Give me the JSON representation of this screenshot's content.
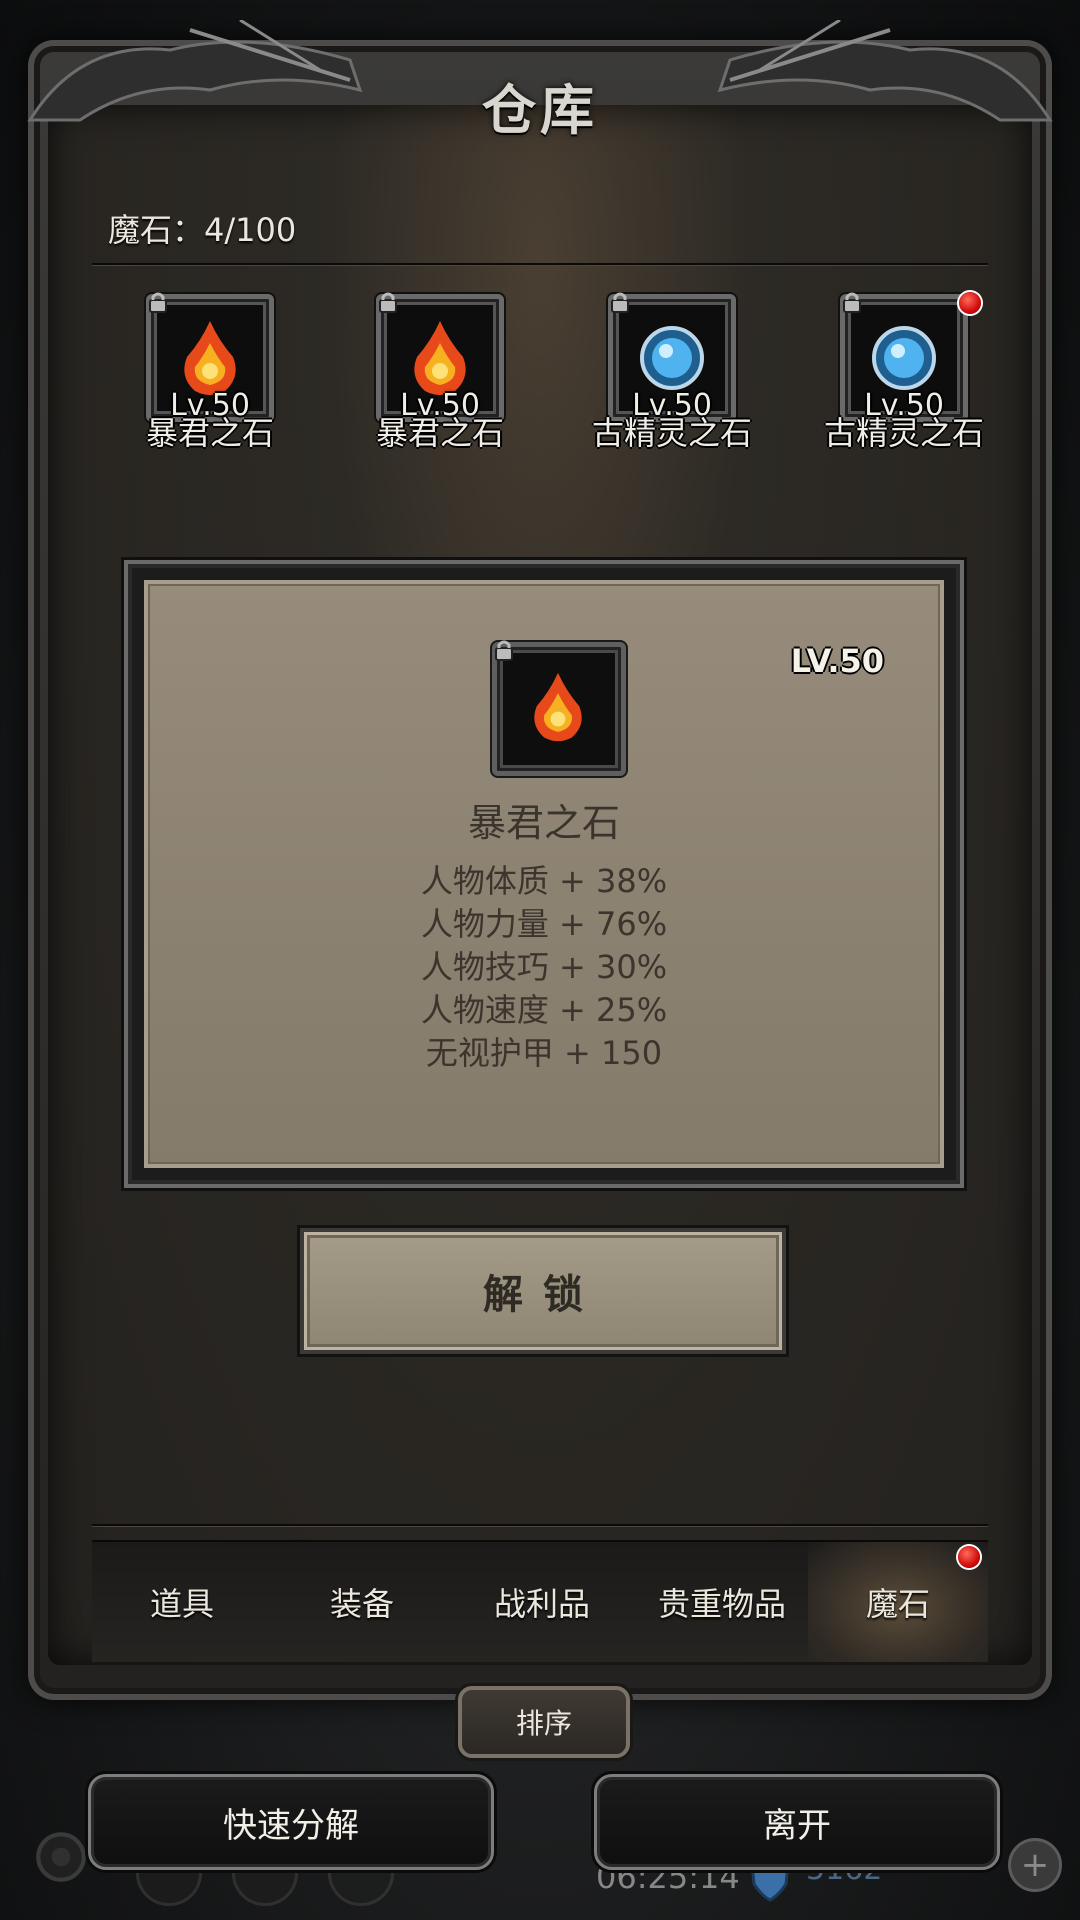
{
  "window": {
    "title": "仓库"
  },
  "inventory": {
    "label": "魔石：4/100"
  },
  "items": [
    {
      "level": "Lv.50",
      "name": "暴君之石",
      "type": "fire"
    },
    {
      "level": "Lv.50",
      "name": "暴君之石",
      "type": "fire"
    },
    {
      "level": "Lv.50",
      "name": "古精灵之石",
      "type": "ice"
    },
    {
      "level": "Lv.50",
      "name": "古精灵之石",
      "type": "ice"
    }
  ],
  "detail": {
    "level": "LV.50",
    "name": "暴君之石",
    "stats": [
      "人物体质 + 38%",
      "人物力量 + 76%",
      "人物技巧 + 30%",
      "人物速度 + 25%",
      "无视护甲 + 150"
    ]
  },
  "actions": {
    "unlock": "解锁",
    "sort": "排序",
    "quick_disassemble": "快速分解",
    "leave": "离开"
  },
  "tabs": [
    "道具",
    "装备",
    "战利品",
    "贵重物品",
    "魔石"
  ],
  "active_tab": "魔石",
  "hud": {
    "time": "06:25:14",
    "currency": "5162"
  },
  "colors": {
    "accent_red": "#d10d0d",
    "card_bg": "#8b8170",
    "text_light": "#ece7dd"
  }
}
